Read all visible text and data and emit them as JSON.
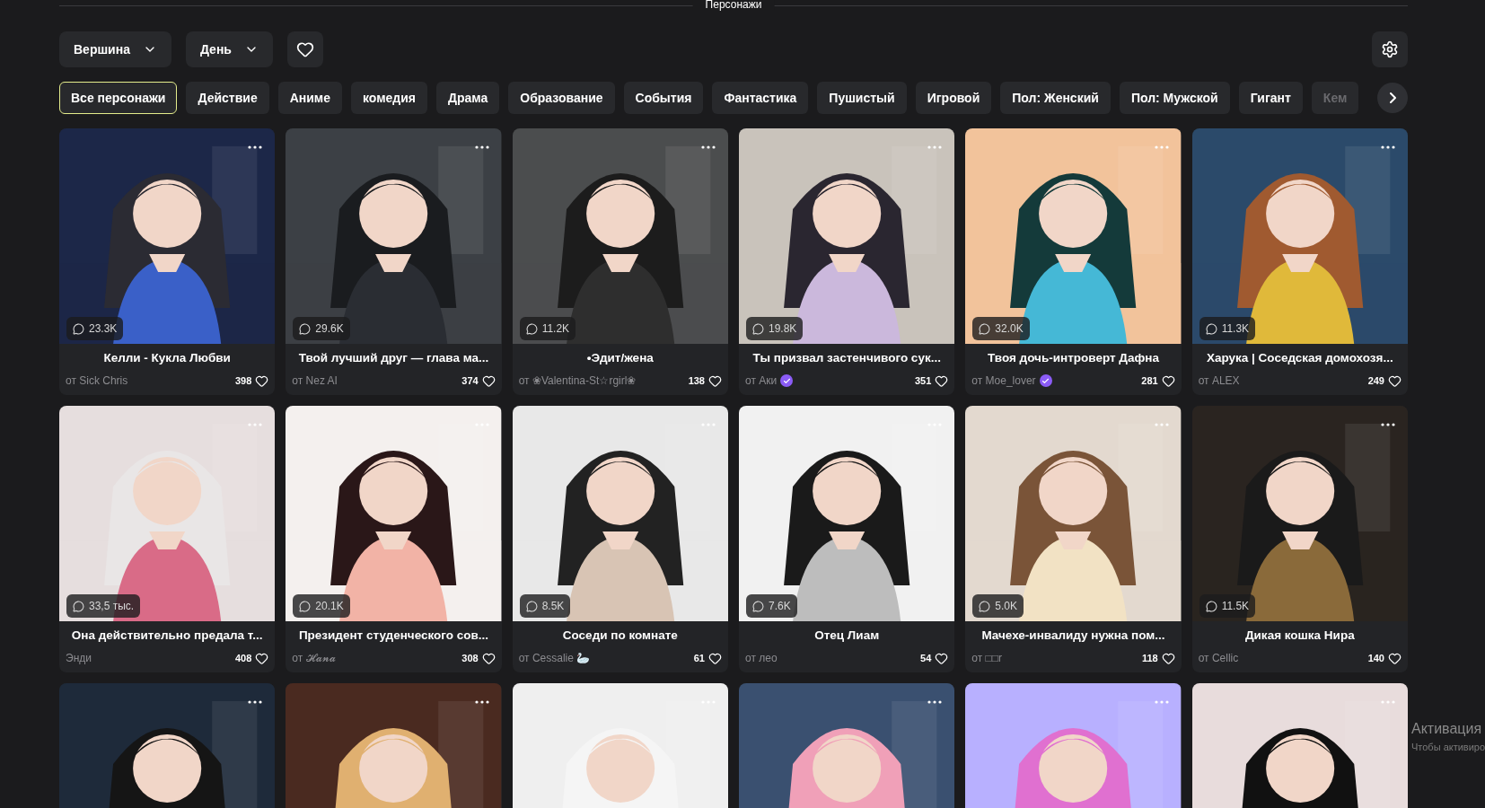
{
  "section_title": "Персонажи",
  "sort": {
    "label": "Вершина"
  },
  "period": {
    "label": "День"
  },
  "categories": [
    {
      "label": "Все персонажи",
      "selected": true
    },
    {
      "label": "Действие",
      "selected": false
    },
    {
      "label": "Аниме",
      "selected": false
    },
    {
      "label": "комедия",
      "selected": false
    },
    {
      "label": "Драма",
      "selected": false
    },
    {
      "label": "Образование",
      "selected": false
    },
    {
      "label": "События",
      "selected": false
    },
    {
      "label": "Фантастика",
      "selected": false
    },
    {
      "label": "Пушистый",
      "selected": false
    },
    {
      "label": "Игровой",
      "selected": false
    },
    {
      "label": "Пол: Женский",
      "selected": false
    },
    {
      "label": "Пол: Мужской",
      "selected": false
    },
    {
      "label": "Гигант",
      "selected": false
    },
    {
      "label": "Кем",
      "selected": false
    }
  ],
  "cards": [
    {
      "chats": "23.3K",
      "title": "Келли - Кукла Любви",
      "author": "от Sick Chris",
      "verified": false,
      "likes": "398"
    },
    {
      "chats": "29.6K",
      "title": "Твой лучший друг — глава ма...",
      "author": "от Nez AI",
      "verified": false,
      "likes": "374"
    },
    {
      "chats": "11.2K",
      "title": "•Эдит/жена",
      "author": "от ❀Valentina-St☆rgirl❀",
      "verified": false,
      "likes": "138"
    },
    {
      "chats": "19.8K",
      "title": "Ты призвал застенчивого сук...",
      "author": "от Аки",
      "verified": true,
      "likes": "351"
    },
    {
      "chats": "32.0K",
      "title": "Твоя дочь-интроверт Дафна",
      "author": "от Moe_lover",
      "verified": true,
      "likes": "281"
    },
    {
      "chats": "11.3K",
      "title": "Харука | Соседская домохозя...",
      "author": "от ALEX",
      "verified": false,
      "likes": "249"
    },
    {
      "chats": "33,5 тыс.",
      "title": "Она действительно предала т...",
      "author": "Энди",
      "verified": false,
      "likes": "408"
    },
    {
      "chats": "20.1K",
      "title": "Президент студенческого сов...",
      "author": "от 𝓗𝓪𝓷𝓪",
      "verified": false,
      "likes": "308"
    },
    {
      "chats": "8.5K",
      "title": "Соседи по комнате",
      "author": "от Cessalie 🦢",
      "verified": false,
      "likes": "61"
    },
    {
      "chats": "7.6K",
      "title": "Отец Лиам",
      "author": "от лео",
      "verified": false,
      "likes": "54"
    },
    {
      "chats": "5.0K",
      "title": "Мачехе-инвалиду нужна пом...",
      "author": "от □□r",
      "verified": false,
      "likes": "118"
    },
    {
      "chats": "11.5K",
      "title": "Дикая кошка Нира",
      "author": "от Cellic",
      "verified": false,
      "likes": "140"
    }
  ],
  "activation_notice": {
    "title": "Активация",
    "text": "Чтобы активиро"
  }
}
